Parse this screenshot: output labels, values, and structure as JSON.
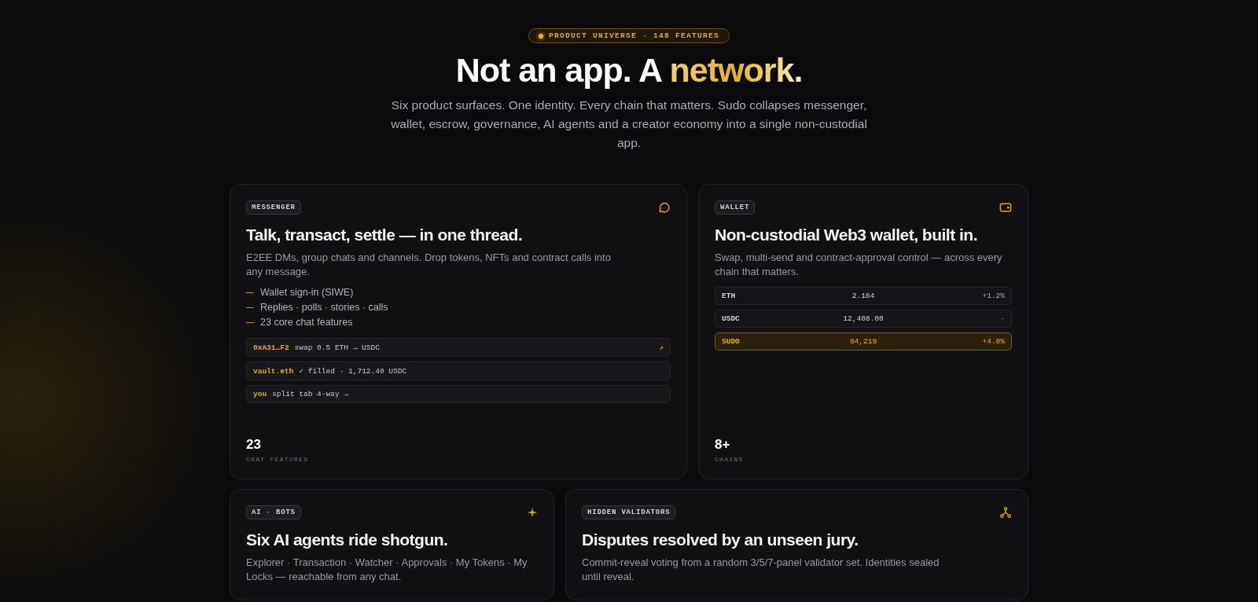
{
  "badge": "PRODUCT UNIVERSE · 148 FEATURES",
  "headline": {
    "plain": "Not an app. A ",
    "accent": "network."
  },
  "intro": "Six product surfaces. One identity. Every chain that matters. Sudo collapses messenger, wallet, escrow, governance, AI agents and a creator economy into a single non-custodial app.",
  "cards": [
    {
      "kind": "messenger",
      "tag": "MESSENGER",
      "title": "Talk, transact, settle — in one thread.",
      "description": "E2EE DMs, group chats and channels. Drop tokens, NFTs and contract calls into any message.",
      "bullets": [
        "Wallet sign-in (SIWE)",
        "Replies · polls · stories · calls",
        "23 core chat features"
      ],
      "messages": [
        {
          "sender": "0xA31…F2",
          "text": "swap 0.5 ETH → USDC",
          "trail": "↗"
        },
        {
          "sender": "vault.eth",
          "text": "✓ filled · 1,712.40 USDC"
        },
        {
          "sender": "you",
          "text": "split tab 4-way →"
        }
      ],
      "stat": {
        "value": "23",
        "label": "CHAT FEATURES"
      }
    },
    {
      "kind": "wallet",
      "tag": "WALLET",
      "title": "Non-custodial Web3 wallet, built in.",
      "description": "Swap, multi-send and contract-approval control — across every chain that matters.",
      "assets": [
        {
          "symbol": "ETH",
          "amount": "2.184",
          "change": "+1.2%",
          "selected": false
        },
        {
          "symbol": "USDC",
          "amount": "12,408.00",
          "change": "·",
          "selected": false
        },
        {
          "symbol": "SUDO",
          "amount": "84,219",
          "change": "+4.8%",
          "selected": true
        }
      ],
      "stat": {
        "value": "8+",
        "label": "CHAINS"
      }
    },
    {
      "kind": "bots",
      "tag": "AI · BOTS",
      "title": "Six AI agents ride shotgun.",
      "description": "Explorer · Transaction · Watcher · Approvals · My Tokens · My Locks — reachable from any chat."
    },
    {
      "kind": "validators",
      "tag": "HIDDEN VALIDATORS",
      "title": "Disputes resolved by an unseen jury.",
      "description": "Commit-reveal voting from a random 3/5/7-panel validator set. Identities sealed until reveal."
    }
  ]
}
